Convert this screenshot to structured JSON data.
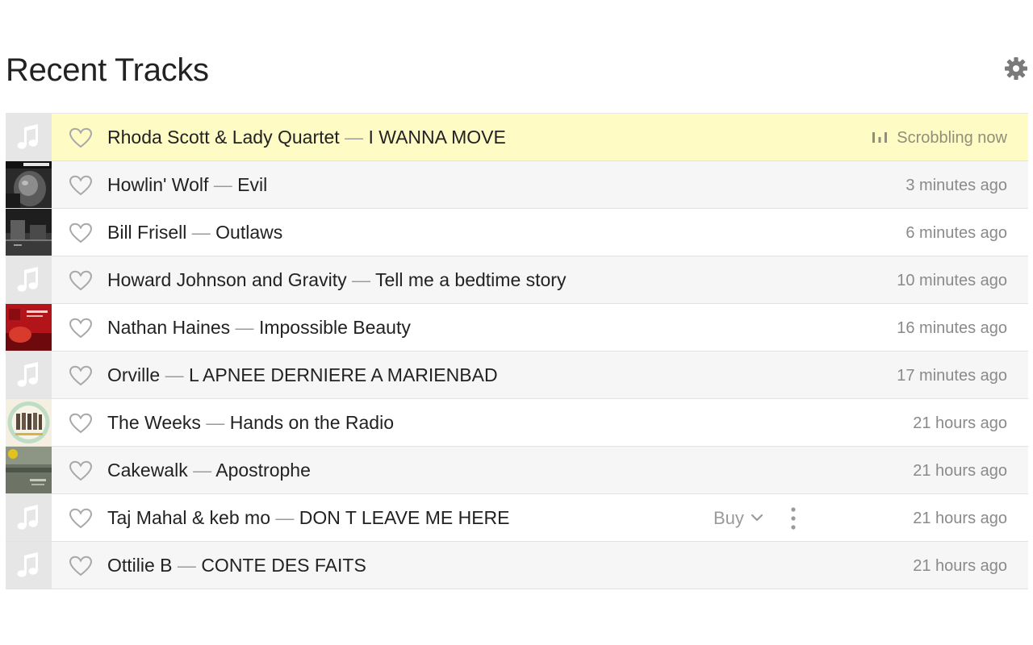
{
  "page": {
    "title": "Recent Tracks",
    "settings_icon": "gear-icon"
  },
  "tracks": [
    {
      "artist": "Rhoda Scott & Lady Quartet",
      "separator": "—",
      "title": "I WANNA MOVE",
      "time": "Scrobbling now",
      "now_playing": true,
      "cover": "placeholder-note"
    },
    {
      "artist": "Howlin' Wolf",
      "separator": "—",
      "title": "Evil",
      "time": "3 minutes ago",
      "cover": "album-art"
    },
    {
      "artist": "Bill Frisell",
      "separator": "—",
      "title": "Outlaws",
      "time": "6 minutes ago",
      "cover": "album-art"
    },
    {
      "artist": "Howard Johnson and Gravity",
      "separator": "—",
      "title": "Tell me a bedtime story",
      "time": "10 minutes ago",
      "cover": "placeholder-note"
    },
    {
      "artist": "Nathan Haines",
      "separator": "—",
      "title": "Impossible Beauty",
      "time": "16 minutes ago",
      "cover": "album-art"
    },
    {
      "artist": "Orville",
      "separator": "—",
      "title": "L APNEE DERNIERE A MARIENBAD",
      "time": "17 minutes ago",
      "cover": "placeholder-note"
    },
    {
      "artist": "The Weeks",
      "separator": "—",
      "title": "Hands on the Radio",
      "time": "21 hours ago",
      "cover": "album-art"
    },
    {
      "artist": "Cakewalk",
      "separator": "—",
      "title": "Apostrophe",
      "time": "21 hours ago",
      "cover": "album-art"
    },
    {
      "artist": "Taj Mahal & keb mo",
      "separator": "—",
      "title": "DON T LEAVE ME HERE",
      "time": "21 hours ago",
      "cover": "placeholder-note",
      "buy_label": "Buy",
      "show_actions": true
    },
    {
      "artist": "Ottilie B",
      "separator": "—",
      "title": "CONTE DES FAITS",
      "time": "21 hours ago",
      "cover": "placeholder-note"
    }
  ],
  "colors": {
    "now_playing_bg": "#fffbc4",
    "alt_row_bg": "#f6f6f6",
    "muted_text": "#8a8a8a",
    "placeholder_bg": "#e6e6e6"
  }
}
